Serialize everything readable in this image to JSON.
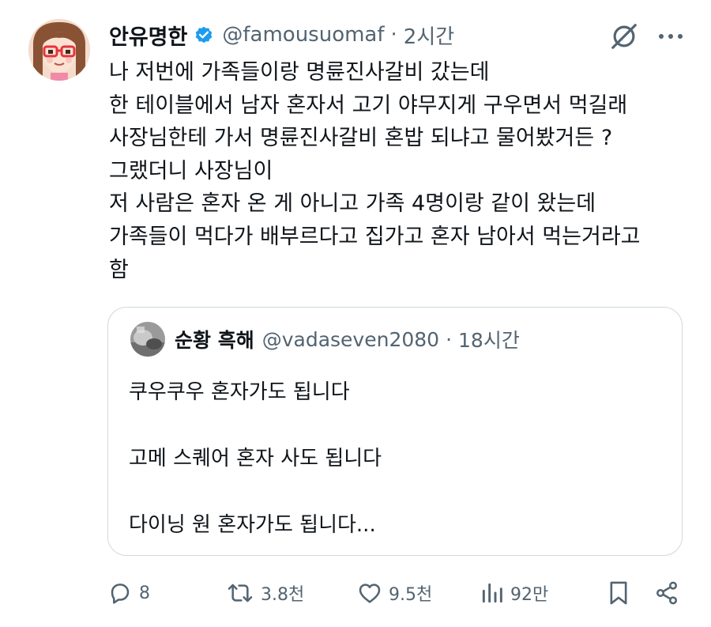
{
  "tweet": {
    "display_name": "안유명한",
    "handle": "@famousuomaf",
    "separator": "·",
    "time": "2시간",
    "body_lines": [
      "나 저번에 가족들이랑 명륜진사갈비 갔는데",
      "한 테이블에서 남자 혼자서 고기 야무지게 구우면서 먹길래",
      "사장님한테 가서 명륜진사갈비 혼밥 되냐고 물어봤거든 ?",
      "그랬더니 사장님이",
      "저 사람은 혼자 온 게 아니고 가족 4명이랑 같이 왔는데",
      "가족들이 먹다가 배부르다고 집가고 혼자 남아서 먹는거라고",
      "함"
    ]
  },
  "quote": {
    "display_name": "순황 흑해",
    "handle": "@vadaseven2080",
    "separator": "·",
    "time": "18시간",
    "lines": [
      "쿠우쿠우 혼자가도 됩니다",
      "고메 스퀘어 혼자 사도 됩니다",
      "다이닝 원 혼자가도 됩니다..."
    ]
  },
  "actions": {
    "replies": "8",
    "retweets": "3.8천",
    "likes": "9.5천",
    "views": "92만"
  },
  "icons": {
    "verified": "verified-badge-icon",
    "grok": "grok-icon",
    "more": "more-icon",
    "reply": "reply-icon",
    "retweet": "retweet-icon",
    "like": "heart-icon",
    "views": "views-icon",
    "bookmark": "bookmark-icon",
    "share": "share-icon"
  },
  "colors": {
    "text": "#0f1419",
    "secondary": "#536471",
    "verified": "#1d9bf0",
    "border": "#cfd9de"
  }
}
